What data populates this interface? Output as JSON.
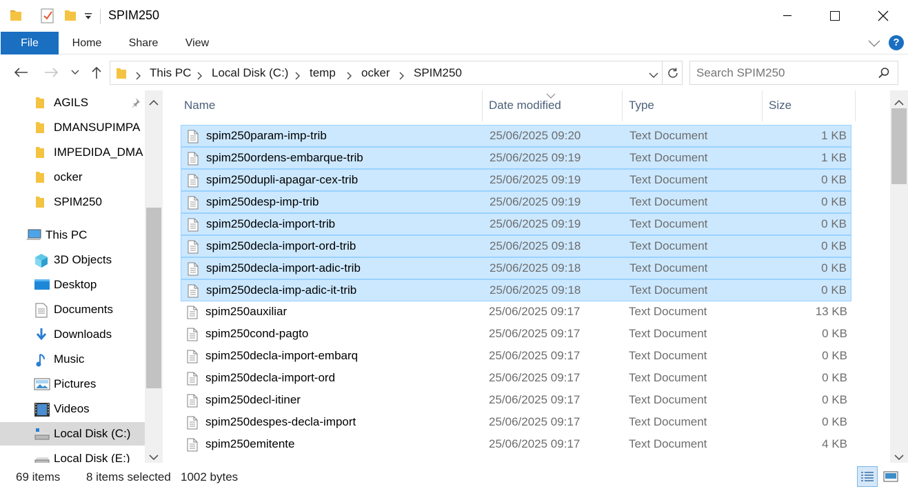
{
  "window": {
    "title": "SPIM250"
  },
  "ribbon": {
    "tabs": [
      "File",
      "Home",
      "Share",
      "View"
    ],
    "help_label": "?"
  },
  "address": {
    "crumbs": [
      "This PC",
      "Local Disk (C:)",
      "temp",
      "ocker",
      "SPIM250"
    ]
  },
  "search": {
    "placeholder": "Search SPIM250"
  },
  "nav": {
    "quick_access": [
      {
        "label": "AGILS",
        "pinned": true
      },
      {
        "label": "DMANSUPIMPA"
      },
      {
        "label": "IMPEDIDA_DMA"
      },
      {
        "label": "ocker"
      },
      {
        "label": "SPIM250"
      }
    ],
    "this_pc_label": "This PC",
    "this_pc_items": [
      {
        "label": "3D Objects",
        "icon": "3d-objects-icon"
      },
      {
        "label": "Desktop",
        "icon": "desktop-icon"
      },
      {
        "label": "Documents",
        "icon": "documents-icon"
      },
      {
        "label": "Downloads",
        "icon": "downloads-icon"
      },
      {
        "label": "Music",
        "icon": "music-icon"
      },
      {
        "label": "Pictures",
        "icon": "pictures-icon"
      },
      {
        "label": "Videos",
        "icon": "videos-icon"
      },
      {
        "label": "Local Disk (C:)",
        "icon": "drive-icon",
        "selected": true
      },
      {
        "label": "Local Disk (E:)",
        "icon": "drive-icon"
      }
    ]
  },
  "columns": {
    "name": "Name",
    "date": "Date modified",
    "type": "Type",
    "size": "Size"
  },
  "files": [
    {
      "name": "spim250param-imp-trib",
      "date": "25/06/2025 09:20",
      "type": "Text Document",
      "size": "1 KB",
      "selected": true
    },
    {
      "name": "spim250ordens-embarque-trib",
      "date": "25/06/2025 09:19",
      "type": "Text Document",
      "size": "1 KB",
      "selected": true
    },
    {
      "name": "spim250dupli-apagar-cex-trib",
      "date": "25/06/2025 09:19",
      "type": "Text Document",
      "size": "0 KB",
      "selected": true
    },
    {
      "name": "spim250desp-imp-trib",
      "date": "25/06/2025 09:19",
      "type": "Text Document",
      "size": "0 KB",
      "selected": true
    },
    {
      "name": "spim250decla-import-trib",
      "date": "25/06/2025 09:19",
      "type": "Text Document",
      "size": "0 KB",
      "selected": true
    },
    {
      "name": "spim250decla-import-ord-trib",
      "date": "25/06/2025 09:18",
      "type": "Text Document",
      "size": "0 KB",
      "selected": true
    },
    {
      "name": "spim250decla-import-adic-trib",
      "date": "25/06/2025 09:18",
      "type": "Text Document",
      "size": "0 KB",
      "selected": true
    },
    {
      "name": "spim250decla-imp-adic-it-trib",
      "date": "25/06/2025 09:18",
      "type": "Text Document",
      "size": "0 KB",
      "selected": true
    },
    {
      "name": "spim250auxiliar",
      "date": "25/06/2025 09:17",
      "type": "Text Document",
      "size": "13 KB",
      "selected": false
    },
    {
      "name": "spim250cond-pagto",
      "date": "25/06/2025 09:17",
      "type": "Text Document",
      "size": "0 KB",
      "selected": false
    },
    {
      "name": "spim250decla-import-embarq",
      "date": "25/06/2025 09:17",
      "type": "Text Document",
      "size": "0 KB",
      "selected": false
    },
    {
      "name": "spim250decla-import-ord",
      "date": "25/06/2025 09:17",
      "type": "Text Document",
      "size": "0 KB",
      "selected": false
    },
    {
      "name": "spim250decl-itiner",
      "date": "25/06/2025 09:17",
      "type": "Text Document",
      "size": "0 KB",
      "selected": false
    },
    {
      "name": "spim250despes-decla-import",
      "date": "25/06/2025 09:17",
      "type": "Text Document",
      "size": "0 KB",
      "selected": false
    },
    {
      "name": "spim250emitente",
      "date": "25/06/2025 09:17",
      "type": "Text Document",
      "size": "4 KB",
      "selected": false
    }
  ],
  "status": {
    "item_count": "69 items",
    "selected_count": "8 items selected",
    "selected_size": "1002 bytes"
  },
  "colors": {
    "accent": "#1a6fc1",
    "selection_fill": "#cce8ff",
    "selection_border": "#99d1ff",
    "folder": "#f5c342"
  }
}
